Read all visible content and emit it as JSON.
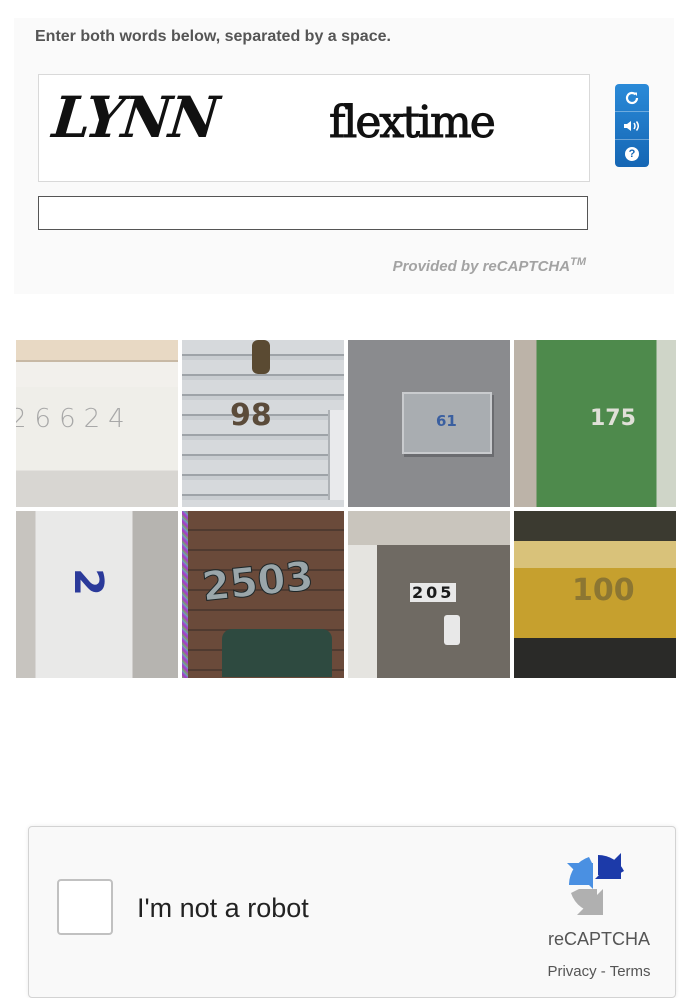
{
  "classic": {
    "instruction": "Enter both words below, separated by a space.",
    "word_1": "LYNN",
    "word_2": "flextime",
    "input_value": "",
    "provided_by": "Provided by reCAPTCHA",
    "trademark": "TM",
    "icons": [
      "refresh-icon",
      "audio-icon",
      "help-icon"
    ]
  },
  "grid": {
    "tiles": [
      {
        "number": "26624"
      },
      {
        "number": "98"
      },
      {
        "number": "61"
      },
      {
        "number": "175"
      },
      {
        "number": "2"
      },
      {
        "number": "2503"
      },
      {
        "number": "205"
      },
      {
        "number": "100"
      }
    ]
  },
  "widget": {
    "checkbox_label": "I'm not a robot",
    "brand": "reCAPTCHA",
    "privacy": "Privacy",
    "separator": " - ",
    "terms": "Terms",
    "colors": {
      "blue": "#1c3aa9",
      "light_blue": "#4a90e2",
      "grey": "#b0b0b0"
    }
  }
}
